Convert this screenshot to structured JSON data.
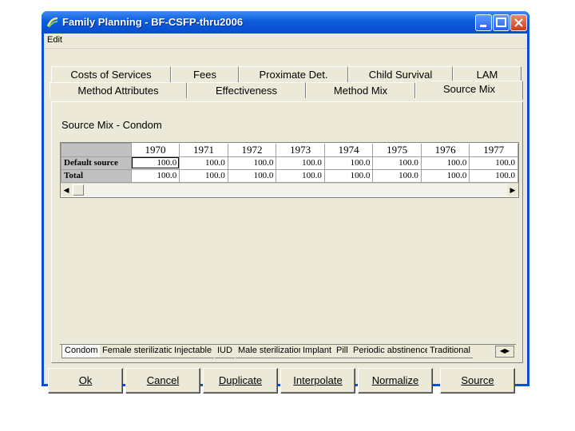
{
  "window": {
    "title": "Family Planning - BF-CSFP-thru2006"
  },
  "menu": {
    "edit": "Edit"
  },
  "tabs_row1": [
    "Costs of Services",
    "Fees",
    "Proximate Det.",
    "Child Survival",
    "LAM"
  ],
  "tabs_row2": [
    "Method Attributes",
    "Effectiveness",
    "Method Mix",
    "Source Mix"
  ],
  "section_title": "Source Mix - Condom",
  "grid": {
    "years": [
      "1970",
      "1971",
      "1972",
      "1973",
      "1974",
      "1975",
      "1976",
      "1977"
    ],
    "rows": [
      {
        "label": "Default source",
        "values": [
          "100.0",
          "100.0",
          "100.0",
          "100.0",
          "100.0",
          "100.0",
          "100.0",
          "100.0"
        ]
      },
      {
        "label": "Total",
        "values": [
          "100.0",
          "100.0",
          "100.0",
          "100.0",
          "100.0",
          "100.0",
          "100.0",
          "100.0"
        ]
      }
    ]
  },
  "method_tabs": [
    "Condom",
    "Female sterilization",
    "Injectable",
    "IUD",
    "Male sterilization",
    "Implant",
    "Pill",
    "Periodic abstinence",
    "Traditional"
  ],
  "buttons": {
    "ok": "Ok",
    "cancel": "Cancel",
    "duplicate": "Duplicate",
    "interpolate": "Interpolate",
    "normalize": "Normalize",
    "source": "Source"
  }
}
